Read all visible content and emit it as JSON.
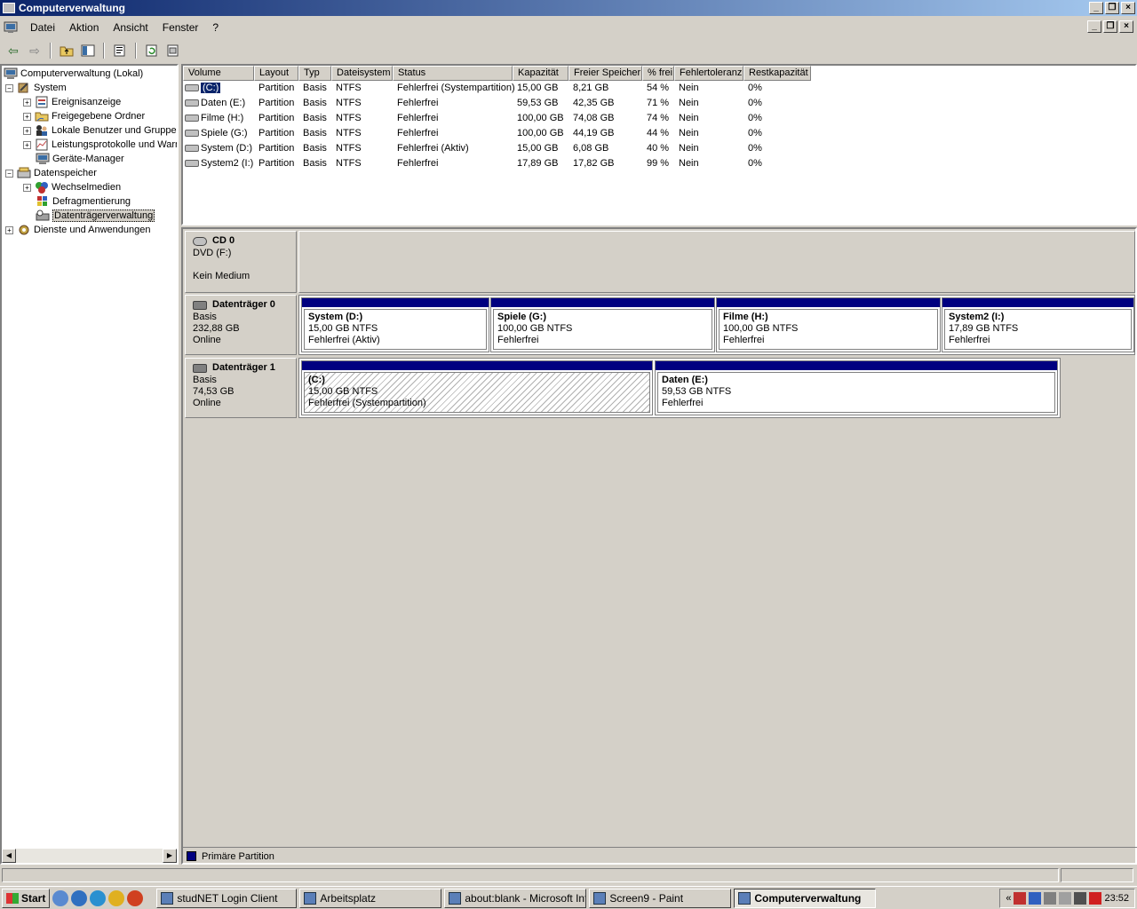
{
  "window": {
    "title": "Computerverwaltung"
  },
  "menu": {
    "items": [
      "Datei",
      "Aktion",
      "Ansicht",
      "Fenster",
      "?"
    ]
  },
  "tree": {
    "items": [
      {
        "label": "Computerverwaltung (Lokal)"
      },
      {
        "label": "System"
      },
      {
        "label": "Ereignisanzeige"
      },
      {
        "label": "Freigegebene Ordner"
      },
      {
        "label": "Lokale Benutzer und Gruppe"
      },
      {
        "label": "Leistungsprotokolle und Warn"
      },
      {
        "label": "Geräte-Manager"
      },
      {
        "label": "Datenspeicher"
      },
      {
        "label": "Wechselmedien"
      },
      {
        "label": "Defragmentierung"
      },
      {
        "label": "Datenträgerverwaltung"
      },
      {
        "label": "Dienste und Anwendungen"
      }
    ]
  },
  "volumes": {
    "columns": [
      "Volume",
      "Layout",
      "Typ",
      "Dateisystem",
      "Status",
      "Kapazität",
      "Freier Speicher",
      "% frei",
      "Fehlertoleranz",
      "Restkapazität"
    ],
    "rows": [
      [
        "(C:)",
        "Partition",
        "Basis",
        "NTFS",
        "Fehlerfrei (Systempartition)",
        "15,00 GB",
        "8,21 GB",
        "54 %",
        "Nein",
        "0%"
      ],
      [
        "Daten (E:)",
        "Partition",
        "Basis",
        "NTFS",
        "Fehlerfrei",
        "59,53 GB",
        "42,35 GB",
        "71 %",
        "Nein",
        "0%"
      ],
      [
        "Filme (H:)",
        "Partition",
        "Basis",
        "NTFS",
        "Fehlerfrei",
        "100,00 GB",
        "74,08 GB",
        "74 %",
        "Nein",
        "0%"
      ],
      [
        "Spiele (G:)",
        "Partition",
        "Basis",
        "NTFS",
        "Fehlerfrei",
        "100,00 GB",
        "44,19 GB",
        "44 %",
        "Nein",
        "0%"
      ],
      [
        "System (D:)",
        "Partition",
        "Basis",
        "NTFS",
        "Fehlerfrei (Aktiv)",
        "15,00 GB",
        "6,08 GB",
        "40 %",
        "Nein",
        "0%"
      ],
      [
        "System2 (I:)",
        "Partition",
        "Basis",
        "NTFS",
        "Fehlerfrei",
        "17,89 GB",
        "17,82 GB",
        "99 %",
        "Nein",
        "0%"
      ]
    ]
  },
  "disks": {
    "cd0": {
      "name": "CD 0",
      "line1": "DVD (F:)",
      "line2": "Kein Medium"
    },
    "disk0": {
      "name": "Datenträger 0",
      "type": "Basis",
      "size": "232,88 GB",
      "state": "Online",
      "partitions": [
        {
          "title": "System  (D:)",
          "size": "15,00 GB NTFS",
          "status": "Fehlerfrei (Aktiv)"
        },
        {
          "title": "Spiele  (G:)",
          "size": "100,00 GB NTFS",
          "status": "Fehlerfrei"
        },
        {
          "title": "Filme  (H:)",
          "size": "100,00 GB NTFS",
          "status": "Fehlerfrei"
        },
        {
          "title": "System2  (I:)",
          "size": "17,89 GB NTFS",
          "status": "Fehlerfrei"
        }
      ]
    },
    "disk1": {
      "name": "Datenträger 1",
      "type": "Basis",
      "size": "74,53 GB",
      "state": "Online",
      "partitions": [
        {
          "title": "(C:)",
          "size": "15,00 GB NTFS",
          "status": "Fehlerfrei (Systempartition)"
        },
        {
          "title": "Daten  (E:)",
          "size": "59,53 GB NTFS",
          "status": "Fehlerfrei"
        }
      ]
    }
  },
  "legend": {
    "label": "Primäre Partition"
  },
  "taskbar": {
    "start": "Start",
    "tasks": [
      "studNET Login Client",
      "Arbeitsplatz",
      "about:blank - Microsoft Int...",
      "Screen9 - Paint",
      "Computerverwaltung"
    ],
    "clock": "23:52"
  },
  "colors": {
    "title_start": "#0a246a",
    "title_end": "#a6caf0",
    "partition_bar": "#000080"
  }
}
